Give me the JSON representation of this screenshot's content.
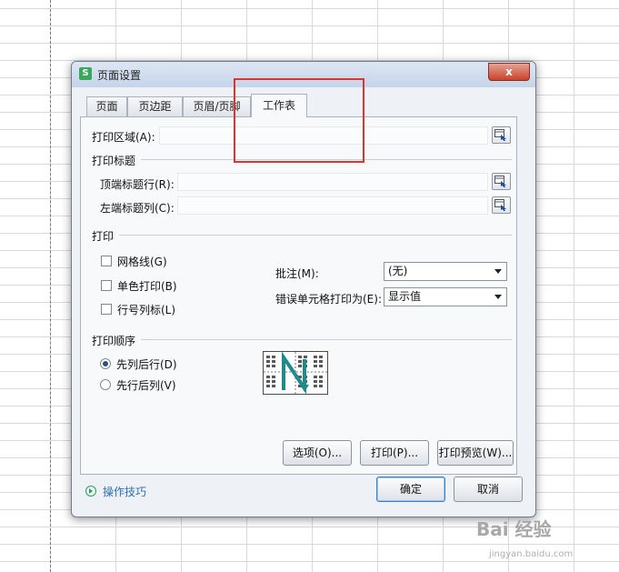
{
  "dialog": {
    "title": "页面设置",
    "app_icon": "S",
    "close": "x"
  },
  "tabs": [
    {
      "label": "页面"
    },
    {
      "label": "页边距"
    },
    {
      "label": "页眉/页脚"
    },
    {
      "label": "工作表",
      "active": true
    }
  ],
  "print_area": {
    "label": "打印区域(A):",
    "value": ""
  },
  "print_titles": {
    "section": "打印标题",
    "top_rows": {
      "label": "顶端标题行(R):",
      "value": ""
    },
    "left_cols": {
      "label": "左端标题列(C):",
      "value": ""
    }
  },
  "print": {
    "section": "打印",
    "gridlines": {
      "label": "网格线(G)",
      "checked": false
    },
    "mono": {
      "label": "单色打印(B)",
      "checked": false
    },
    "headings": {
      "label": "行号列标(L)",
      "checked": false
    },
    "comments": {
      "label": "批注(M):",
      "value": "(无)"
    },
    "errors": {
      "label": "错误单元格打印为(E):",
      "value": "显示值"
    }
  },
  "print_order": {
    "section": "打印顺序",
    "down_then_over": {
      "label": "先列后行(D)",
      "selected": true
    },
    "over_then_down": {
      "label": "先行后列(V)",
      "selected": false
    }
  },
  "buttons": {
    "options": "选项(O)...",
    "print": "打印(P)...",
    "preview": "打印预览(W)...",
    "ok": "确定",
    "cancel": "取消"
  },
  "tips": {
    "label": "操作技巧",
    "icon": "play-circle-icon"
  },
  "watermark": {
    "main": "Bai 经验",
    "sub": "jingyan.baidu.com"
  },
  "colors": {
    "highlight": "#e0332c",
    "accent_link": "#2d6fb5",
    "brand": "#3aa75a"
  }
}
